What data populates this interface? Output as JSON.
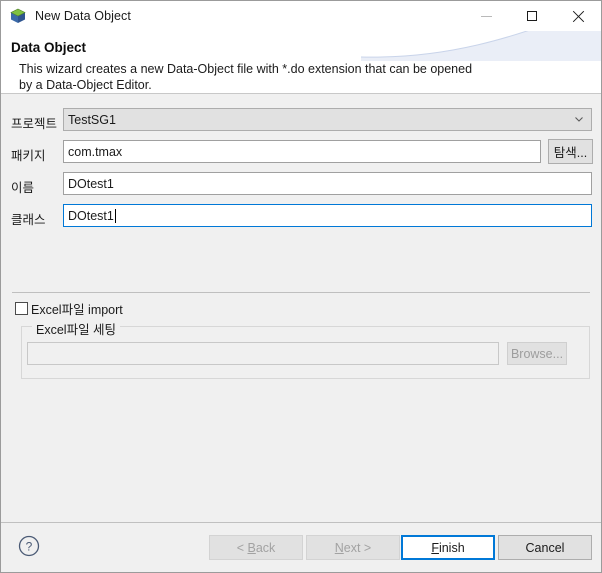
{
  "window": {
    "title": "New Data Object",
    "icon": "data-object-cube-icon",
    "controls": {
      "minimize": "minimize-icon",
      "maximize": "maximize-icon",
      "close": "close-icon"
    }
  },
  "header": {
    "title": "Data Object",
    "description": "This wizard creates a new Data-Object file with *.do extension that can be opened\nby a Data-Object Editor."
  },
  "form": {
    "project": {
      "label": "프로젝트",
      "value": "TestSG1",
      "icon": "chevron-down-icon"
    },
    "package": {
      "label": "패키지",
      "value": "com.tmax",
      "browse_label": "탐색..."
    },
    "name": {
      "label": "이름",
      "value": "DOtest1"
    },
    "class": {
      "label": "클래스",
      "value": "DOtest1"
    }
  },
  "excel": {
    "import_label": "Excel파일 import",
    "import_checked": false,
    "group_title": "Excel파일 세팅",
    "path_value": "",
    "browse_label": "Browse..."
  },
  "footer": {
    "help": "help-icon",
    "back": "< Back",
    "back_mnemonic": "B",
    "next": "Next >",
    "next_mnemonic": "N",
    "finish": "Finish",
    "finish_mnemonic": "F",
    "cancel": "Cancel"
  },
  "colors": {
    "accent": "#0078d7",
    "body_bg": "#f0f0f0",
    "header_bg": "#ffffff"
  }
}
